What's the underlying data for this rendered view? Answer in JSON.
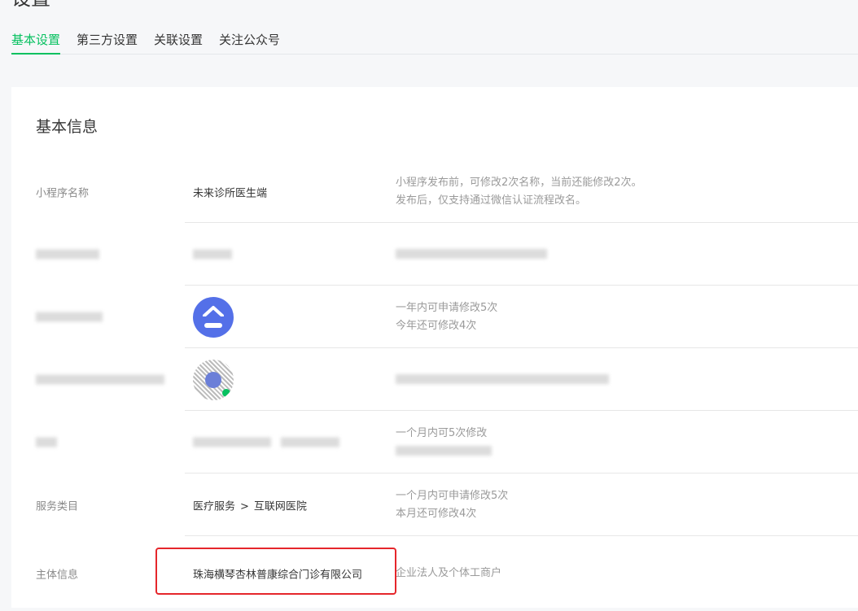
{
  "page": {
    "title": "设置"
  },
  "tabs": [
    {
      "label": "基本设置",
      "active": true
    },
    {
      "label": "第三方设置",
      "active": false
    },
    {
      "label": "关联设置",
      "active": false
    },
    {
      "label": "关注公众号",
      "active": false
    }
  ],
  "panel": {
    "title": "基本信息"
  },
  "rows": {
    "name": {
      "label": "小程序名称",
      "value": "未来诊所医生端",
      "desc_line1": "小程序发布前，可修改2次名称，当前还能修改2次。",
      "desc_line2": "发布后，仅支持通过微信认证流程改名。"
    },
    "avatar": {
      "desc_line1": "一年内可申请修改5次",
      "desc_line2": "今年还可修改4次"
    },
    "intro": {
      "desc_line1": "一个月内可5次修改"
    },
    "category": {
      "label": "服务类目",
      "value_part1": "医疗服务",
      "arrow": ">",
      "value_part2": "互联网医院",
      "desc_line1": "一个月内可申请修改5次",
      "desc_line2": "本月还可修改4次"
    },
    "subject": {
      "label": "主体信息",
      "value": "珠海横琴杏林普康综合门诊有限公司",
      "desc_line1": "企业法人及个体工商户"
    }
  },
  "colors": {
    "accent": "#07c160",
    "highlight": "#e5262b"
  }
}
